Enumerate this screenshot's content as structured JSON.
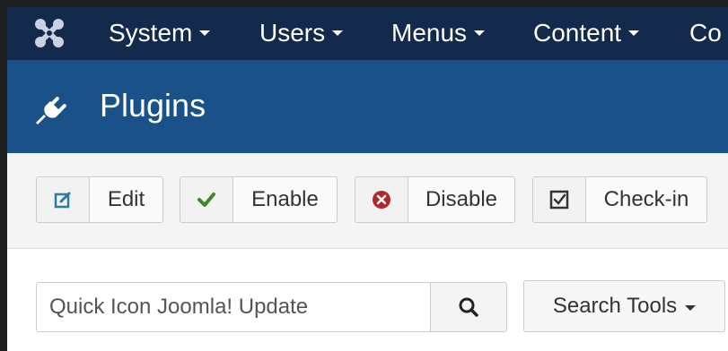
{
  "navbar": {
    "logo_icon": "joomla-logo-icon",
    "items": [
      {
        "label": "System"
      },
      {
        "label": "Users"
      },
      {
        "label": "Menus"
      },
      {
        "label": "Content"
      },
      {
        "label": "Co"
      }
    ]
  },
  "header": {
    "title": "Plugins",
    "icon": "plug-icon"
  },
  "toolbar": {
    "buttons": [
      {
        "label": "Edit",
        "icon": "edit-icon",
        "icon_color": "#2a7d9e"
      },
      {
        "label": "Enable",
        "icon": "check-icon",
        "icon_color": "#3a8a28"
      },
      {
        "label": "Disable",
        "icon": "times-circle-icon",
        "icon_color": "#b0282c"
      },
      {
        "label": "Check-in",
        "icon": "checkbox-icon",
        "icon_color": "#333333"
      }
    ]
  },
  "search": {
    "value": "Quick Icon Joomla! Update",
    "button_icon": "search-icon",
    "tools_label": "Search Tools"
  },
  "colors": {
    "navbar": "#132a4c",
    "header": "#1a5189",
    "toolbar": "#f4f4f4"
  }
}
